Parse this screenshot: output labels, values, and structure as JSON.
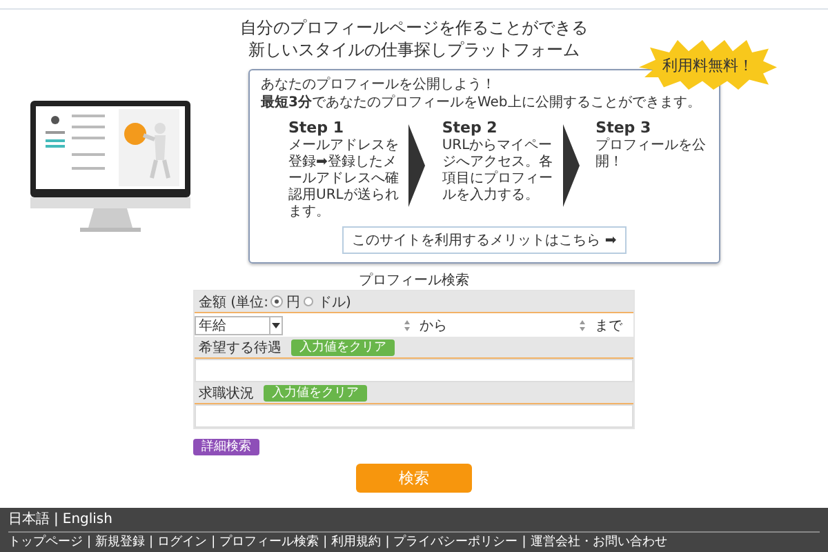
{
  "header": {
    "title_lines": [
      "自分のプロフィールページを作ることができる",
      "新しいスタイルの仕事探しプラットフォーム"
    ]
  },
  "hero": {
    "badge": "利用料無料！",
    "intro": "あなたのプロフィールを公開しよう！",
    "lead": "**最短3分**であなたのプロフィールをWeb上に公開することができます。",
    "steps": [
      {
        "title": "Step 1",
        "text": "メールアドレスを登録➡登録したメールアドレスへ確認用URLが送られます。"
      },
      {
        "title": "Step 2",
        "text": "URLからマイページへアクセス。各項目にプロフィールを入力する。"
      },
      {
        "title": "Step 3",
        "text": "プロフィールを公開！"
      }
    ],
    "merit_link": "このサイトを利用するメリットはこちら ➡"
  },
  "search": {
    "title": "プロフィール検索",
    "amount": {
      "label": "金額 (単位:",
      "units": [
        {
          "label": "円",
          "selected": true
        },
        {
          "label": "ドル)",
          "selected": false
        }
      ],
      "select_value": "年給",
      "from_label": "から",
      "to_label": "まで"
    },
    "fields": [
      {
        "label": "希望する待遇",
        "clear_button": "入力値をクリア"
      },
      {
        "label": "求職状況",
        "clear_button": "入力値をクリア"
      }
    ],
    "advanced_button": "詳細検索",
    "submit_button": "検索"
  },
  "footer": {
    "separator": "|",
    "languages": [
      "日本語",
      "English"
    ],
    "links": [
      "トップページ",
      "新規登録",
      "ログイン",
      "プロフィール検索",
      "利用規約",
      "プライバシーポリシー",
      "運営会社・お問い合わせ"
    ]
  }
}
